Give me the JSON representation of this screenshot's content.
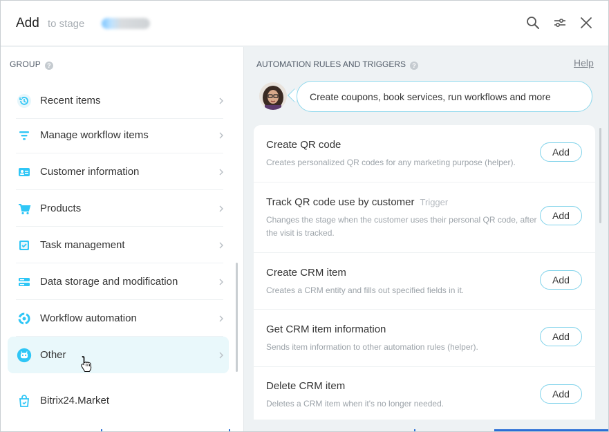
{
  "header": {
    "title": "Add",
    "subtitle": "to stage",
    "search_icon": "search-icon",
    "settings_icon": "sliders-icon",
    "close_icon": "close-icon"
  },
  "left_panel": {
    "group_title": "GROUP",
    "help_badge": "?",
    "items": [
      {
        "label": "Recent items",
        "icon": "recent-icon"
      },
      {
        "label": "Manage workflow items",
        "icon": "filter-icon"
      },
      {
        "label": "Customer information",
        "icon": "contact-card-icon"
      },
      {
        "label": "Products",
        "icon": "cart-icon"
      },
      {
        "label": "Task management",
        "icon": "task-icon"
      },
      {
        "label": "Data storage and modification",
        "icon": "storage-icon"
      },
      {
        "label": "Workflow automation",
        "icon": "automation-icon"
      },
      {
        "label": "Other",
        "icon": "robot-icon",
        "active": true
      },
      {
        "label": "Bitrix24.Market",
        "icon": "market-bag-icon"
      }
    ]
  },
  "right_panel": {
    "title": "AUTOMATION RULES AND TRIGGERS",
    "help_badge": "?",
    "help_link": "Help",
    "bubble_text": "Create coupons, book services, run workflows and more",
    "rules": [
      {
        "title": "Create QR code",
        "tag": "",
        "description": "Creates personalized QR codes for any marketing purpose (helper).",
        "button": "Add"
      },
      {
        "title": "Track QR code use by customer",
        "tag": "Trigger",
        "description": "Changes the stage when the customer uses their personal QR code, after the visit is tracked.",
        "button": "Add"
      },
      {
        "title": "Create CRM item",
        "tag": "",
        "description": "Creates a CRM entity and fills out specified fields in it.",
        "button": "Add"
      },
      {
        "title": "Get CRM item information",
        "tag": "",
        "description": "Sends item information to other automation rules (helper).",
        "button": "Add"
      },
      {
        "title": "Delete CRM item",
        "tag": "",
        "description": "Deletes a CRM item when it's no longer needed.",
        "button": "Add"
      }
    ]
  },
  "colors": {
    "accent": "#2fc6f6",
    "active_bg": "#e9f8fb",
    "button_border": "#7fd2ea"
  }
}
